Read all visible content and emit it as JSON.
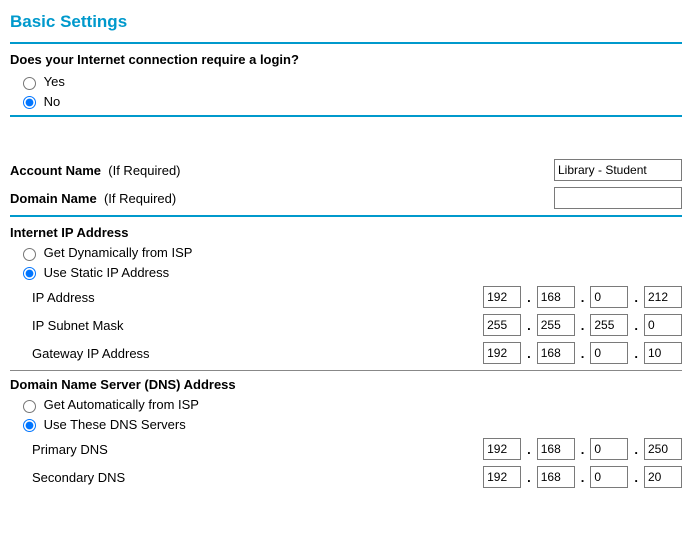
{
  "title": "Basic Settings",
  "login_question": "Does your Internet connection require a login?",
  "login_options": {
    "yes": "Yes",
    "no": "No"
  },
  "login_selected": "no",
  "account": {
    "label": "Account Name",
    "hint": "(If Required)",
    "value": "Library - Student"
  },
  "domain": {
    "label": "Domain Name",
    "hint": "(If Required)",
    "value": ""
  },
  "ip_section": {
    "heading": "Internet IP Address",
    "opt_dynamic": "Get Dynamically from ISP",
    "opt_static": "Use Static IP Address",
    "selected": "static",
    "ip_label": "IP Address",
    "ip": {
      "a": "192",
      "b": "168",
      "c": "0",
      "d": "212"
    },
    "mask_label": "IP Subnet Mask",
    "mask": {
      "a": "255",
      "b": "255",
      "c": "255",
      "d": "0"
    },
    "gw_label": "Gateway IP Address",
    "gw": {
      "a": "192",
      "b": "168",
      "c": "0",
      "d": "10"
    }
  },
  "dns_section": {
    "heading": "Domain Name Server (DNS) Address",
    "opt_auto": "Get Automatically from ISP",
    "opt_manual": "Use These DNS Servers",
    "selected": "manual",
    "primary_label": "Primary DNS",
    "primary": {
      "a": "192",
      "b": "168",
      "c": "0",
      "d": "250"
    },
    "secondary_label": "Secondary DNS",
    "secondary": {
      "a": "192",
      "b": "168",
      "c": "0",
      "d": "20"
    }
  }
}
